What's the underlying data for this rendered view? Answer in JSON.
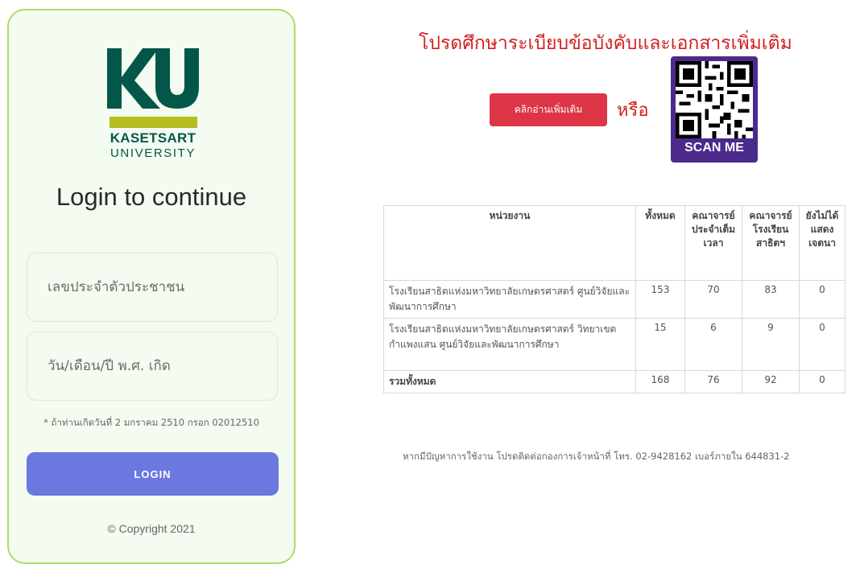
{
  "login": {
    "logo": {
      "ku": "KU",
      "name": "KASETSART",
      "sub": "UNIVERSITY"
    },
    "title": "Login to continue",
    "id_placeholder": "เลขประจำตัวประชาชน",
    "dob_placeholder": "วัน/เดือน/ปี พ.ศ. เกิด",
    "hint": "* ถ้าท่านเกิดวันที่ 2 มกราคม 2510 กรอก 02012510",
    "button_label": "LOGIN",
    "copyright": "© Copyright 2021"
  },
  "notice": {
    "headline": "โปรดศึกษาระเบียบข้อบังคับและเอกสารเพิ่มเติม",
    "read_more_label": "คลิกอ่านเพิ่มเติม",
    "or_label": "หรือ",
    "qr_label": "SCAN ME"
  },
  "table": {
    "headers": [
      "หน่วยงาน",
      "ทั้งหมด",
      "คณาจารย์ประจำเต็มเวลา",
      "คณาจารย์โรงเรียนสาธิตฯ",
      "ยังไม่ได้แสดงเจตนา"
    ],
    "rows": [
      {
        "unit": "โรงเรียนสาธิตแห่งมหาวิทยาลัยเกษตรศาสตร์ ศูนย์วิจัยและพัฒนาการศึกษา",
        "total": "153",
        "fulltime": "70",
        "demo": "83",
        "pending": "0"
      },
      {
        "unit": "โรงเรียนสาธิตแห่งมหาวิทยาลัยเกษตรศาสตร์ วิทยาเขตกำแพงแสน ศูนย์วิจัยและพัฒนาการศึกษา",
        "total": "15",
        "fulltime": "6",
        "demo": "9",
        "pending": "0"
      }
    ],
    "summary": {
      "label": "รวมทั้งหมด",
      "total": "168",
      "fulltime": "76",
      "demo": "92",
      "pending": "0"
    }
  },
  "contact": "หากมีปัญหาการใช้งาน โปรดติดต่อกองการเจ้าหน้าที่ โทร. 02-9428162 เบอร์ภายใน 644831-2",
  "colors": {
    "accent": "#6b78e0",
    "brand": "#035749",
    "alert": "#d21f1f",
    "border": "#a9dd6a"
  }
}
